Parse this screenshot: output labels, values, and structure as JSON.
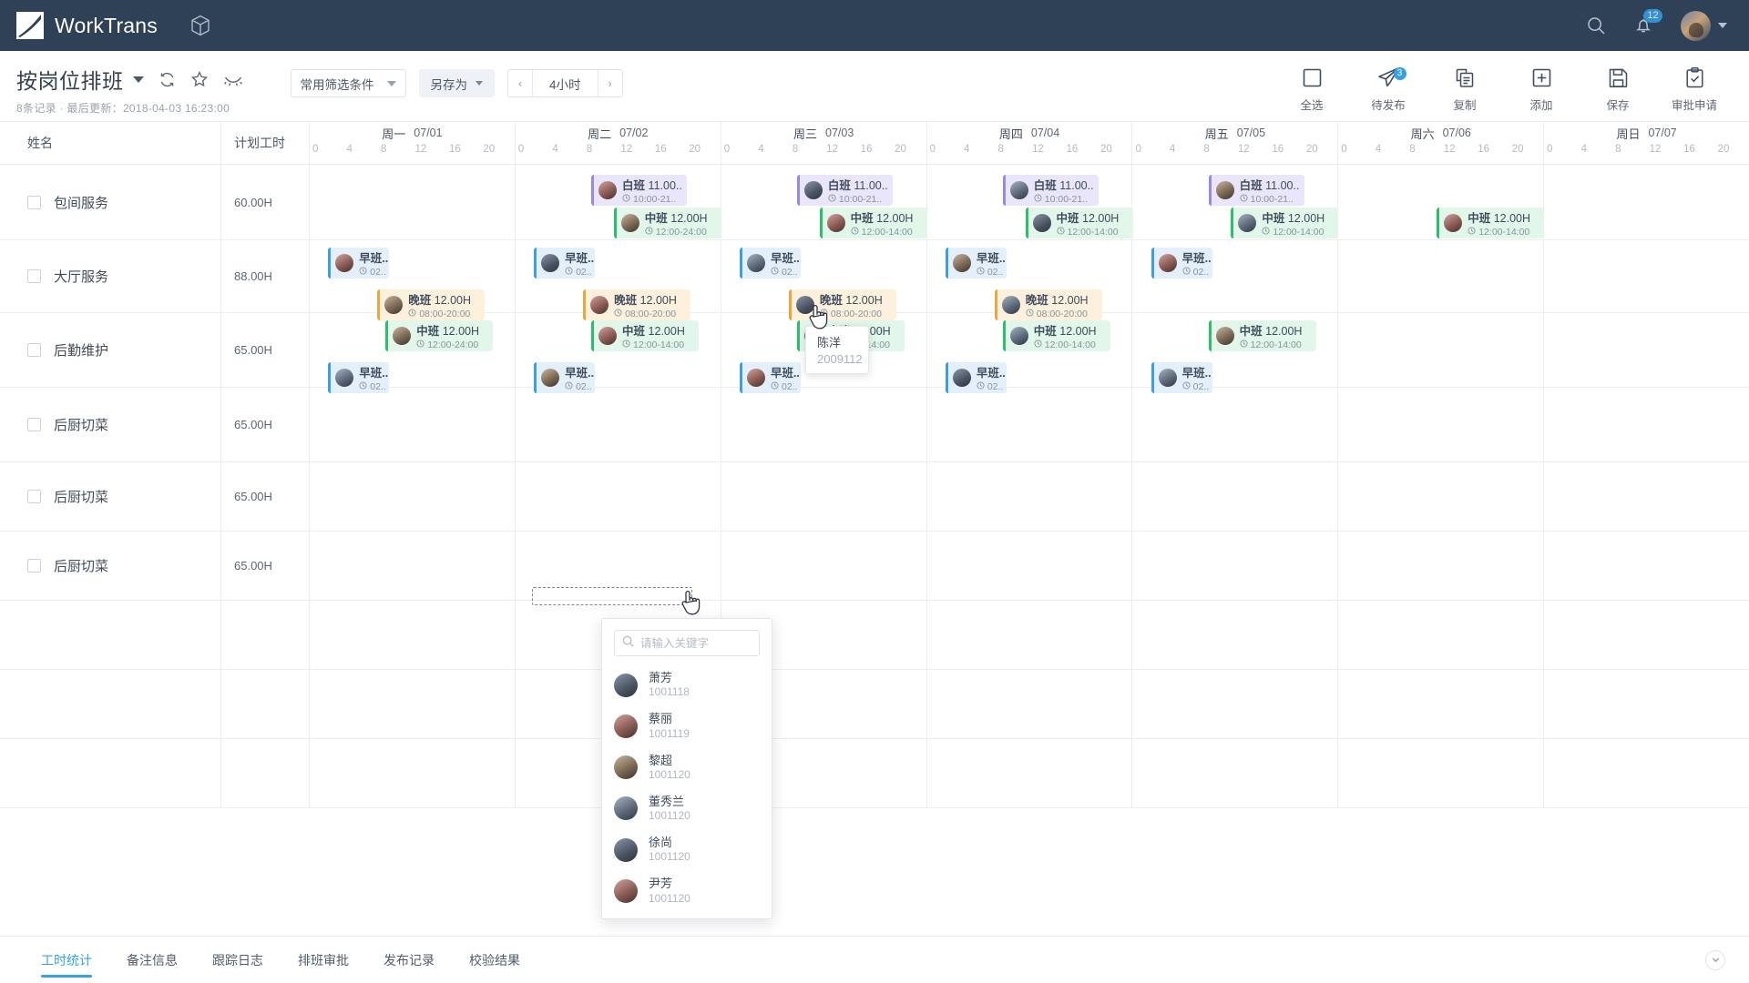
{
  "topnav": {
    "brand": "WorkTrans",
    "cube_icon": "cube-icon",
    "search_icon": "search-icon",
    "bell_icon": "bell-icon",
    "notification_count": "12",
    "avatar_icon": "avatar",
    "avatar_caret_icon": "chevron-down-icon"
  },
  "pagehead": {
    "title": "按岗位排班",
    "title_caret_icon": "caret-down-icon",
    "refresh_icon": "refresh-icon",
    "favorite_icon": "star-icon",
    "hide_icon": "eye-closed-icon",
    "meta": "8条记录 · 最后更新：2018-04-03 16:23:00",
    "filter_label": "常用筛选条件",
    "saveas_label": "另存为",
    "zoom_prev": "‹",
    "zoom_value": "4小时",
    "zoom_next": "›"
  },
  "tools": [
    {
      "label": "全选",
      "icon": "select-all-icon",
      "badge": ""
    },
    {
      "label": "待发布",
      "icon": "publish-icon",
      "badge": "3"
    },
    {
      "label": "复制",
      "icon": "copy-icon",
      "badge": ""
    },
    {
      "label": "添加",
      "icon": "add-icon",
      "badge": ""
    },
    {
      "label": "保存",
      "icon": "save-icon",
      "badge": ""
    },
    {
      "label": "审批申请",
      "icon": "approval-icon",
      "badge": ""
    }
  ],
  "grid": {
    "col_name": "姓名",
    "col_hours": "计划工时",
    "hour_ticks": [
      "0",
      "4",
      "8",
      "12",
      "16",
      "20"
    ],
    "days": [
      {
        "dow": "周一",
        "date": "07/01"
      },
      {
        "dow": "周二",
        "date": "07/02"
      },
      {
        "dow": "周三",
        "date": "07/03"
      },
      {
        "dow": "周四",
        "date": "07/04"
      },
      {
        "dow": "周五",
        "date": "07/05"
      },
      {
        "dow": "周六",
        "date": "07/06"
      },
      {
        "dow": "周日",
        "date": "07/07"
      }
    ],
    "rows": [
      {
        "name": "包间服务",
        "hours": "60.00H"
      },
      {
        "name": "大厅服务",
        "hours": "88.00H"
      },
      {
        "name": "后勤维护",
        "hours": "65.00H"
      },
      {
        "name": "后厨切菜",
        "hours": "65.00H"
      },
      {
        "name": "后厨切菜",
        "hours": "65.00H"
      },
      {
        "name": "后厨切菜",
        "hours": "65.00H"
      },
      {
        "name": "",
        "hours": ""
      },
      {
        "name": "",
        "hours": ""
      },
      {
        "name": "",
        "hours": ""
      }
    ],
    "shift_labels": {
      "bai": {
        "name": "白班",
        "hours": "11.00..",
        "time": "10:00-21.."
      },
      "zhong": {
        "name": "中班",
        "hours": "12.00H",
        "time": "12:00-14:00"
      },
      "zhong24": {
        "name": "中班",
        "hours": "12.00H",
        "time": "12:00-24:00"
      },
      "zao": {
        "name": "早班..",
        "hours": "",
        "time": "02.."
      },
      "wan": {
        "name": "晚班",
        "hours": "12.00H",
        "time": "08:00-20:00"
      }
    }
  },
  "tooltip": {
    "name": "陈洋",
    "id": "2009112"
  },
  "picker": {
    "search_placeholder": "请输入关键字",
    "search_value": "",
    "search_icon": "search-icon",
    "items": [
      {
        "name": "萧芳",
        "id": "1001118"
      },
      {
        "name": "蔡丽",
        "id": "1001119"
      },
      {
        "name": "黎超",
        "id": "1001120"
      },
      {
        "name": "董秀兰",
        "id": "1001120"
      },
      {
        "name": "徐尚",
        "id": "1001120"
      },
      {
        "name": "尹芳",
        "id": "1001120"
      }
    ]
  },
  "bottom_tabs": [
    {
      "label": "工时统计",
      "active": true
    },
    {
      "label": "备注信息",
      "active": false
    },
    {
      "label": "跟踪日志",
      "active": false
    },
    {
      "label": "排班审批",
      "active": false
    },
    {
      "label": "发布记录",
      "active": false
    },
    {
      "label": "校验结果",
      "active": false
    }
  ],
  "collapse_icon": "chevron-down-icon",
  "colors": {
    "navbar": "#2e4156",
    "accent": "#35a0e8",
    "shift_purple": "#9a87e8",
    "shift_green": "#2bbf6c",
    "shift_blue": "#3d9ee0",
    "shift_amber": "#eaa83c"
  }
}
